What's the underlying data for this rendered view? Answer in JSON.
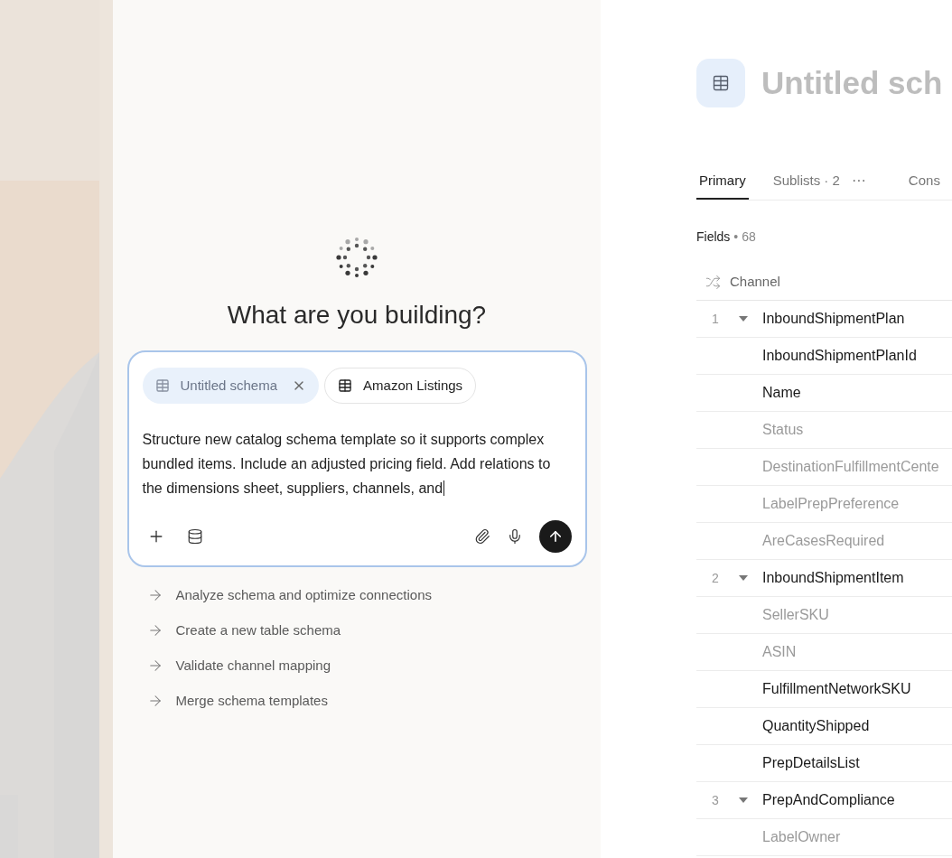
{
  "assistant": {
    "title": "What are you building?",
    "chips": [
      {
        "label": "Untitled schema",
        "selected": true,
        "removable": true
      },
      {
        "label": "Amazon Listings",
        "selected": false,
        "removable": false
      }
    ],
    "prompt": "Structure new catalog schema template so it supports complex bundled items. Include an adjusted pricing field. Add relations to the dimensions sheet, suppliers, channels, and",
    "suggestions": [
      "Analyze schema and optimize connections",
      "Create a new table schema",
      "Validate channel mapping",
      "Merge schema templates"
    ]
  },
  "schema": {
    "title": "Untitled sch",
    "tabs": [
      {
        "kind": "tab",
        "label": "Primary",
        "selected": true
      },
      {
        "kind": "tab",
        "label": "Sublists · 2",
        "selected": false
      },
      {
        "kind": "more",
        "label": "···",
        "selected": false
      },
      {
        "kind": "tab",
        "label": "Cons",
        "selected": false
      }
    ],
    "fields_label": "Fields",
    "fields_count": "• 68",
    "header": "Channel",
    "rows": [
      {
        "number": "1",
        "name": "InboundShipmentPlan",
        "expanded": true,
        "children": [
          {
            "name": "InboundShipmentPlanId",
            "dimmed": false
          },
          {
            "name": "Name",
            "dimmed": false
          },
          {
            "name": "Status",
            "dimmed": true
          },
          {
            "name": "DestinationFulfillmentCente",
            "dimmed": true
          },
          {
            "name": "LabelPrepPreference",
            "dimmed": true
          },
          {
            "name": "AreCasesRequired",
            "dimmed": true
          }
        ]
      },
      {
        "number": "2",
        "name": "InboundShipmentItem",
        "expanded": true,
        "children": [
          {
            "name": "SellerSKU",
            "dimmed": true
          },
          {
            "name": "ASIN",
            "dimmed": true
          },
          {
            "name": "FulfillmentNetworkSKU",
            "dimmed": false
          },
          {
            "name": "QuantityShipped",
            "dimmed": false
          },
          {
            "name": "PrepDetailsList",
            "dimmed": false
          }
        ]
      },
      {
        "number": "3",
        "name": "PrepAndCompliance",
        "expanded": true,
        "children": [
          {
            "name": "LabelOwner",
            "dimmed": true
          }
        ]
      }
    ]
  }
}
